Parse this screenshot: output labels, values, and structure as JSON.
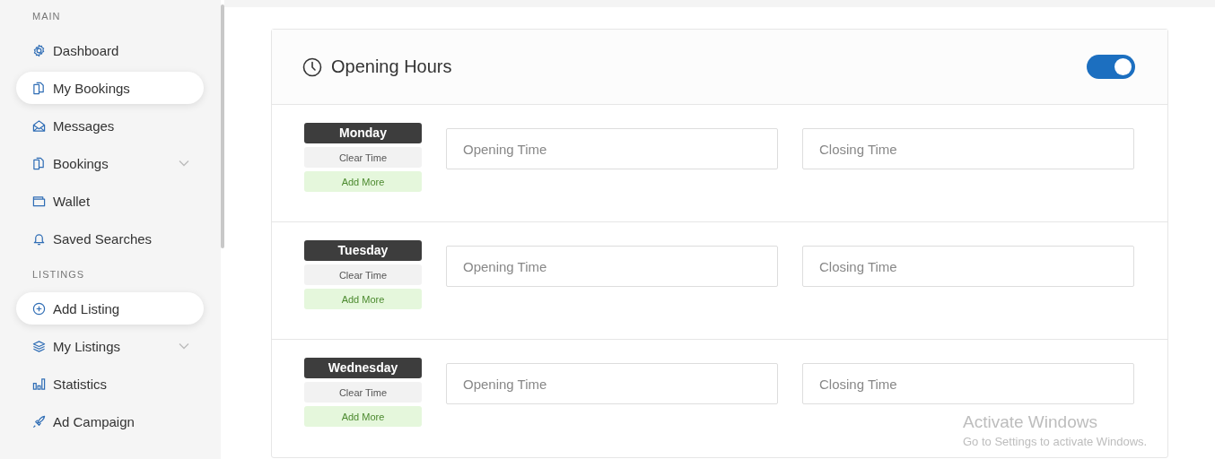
{
  "sidebar": {
    "sections": [
      {
        "heading": "MAIN",
        "items": [
          {
            "label": "Dashboard",
            "selected": false,
            "expandable": false
          },
          {
            "label": "My Bookings",
            "selected": true,
            "expandable": false
          },
          {
            "label": "Messages",
            "selected": false,
            "expandable": false
          },
          {
            "label": "Bookings",
            "selected": false,
            "expandable": true
          },
          {
            "label": "Wallet",
            "selected": false,
            "expandable": false
          },
          {
            "label": "Saved Searches",
            "selected": false,
            "expandable": false
          }
        ]
      },
      {
        "heading": "LISTINGS",
        "items": [
          {
            "label": "Add Listing",
            "selected": true,
            "expandable": false
          },
          {
            "label": "My Listings",
            "selected": false,
            "expandable": true
          },
          {
            "label": "Statistics",
            "selected": false,
            "expandable": false
          },
          {
            "label": "Ad Campaign",
            "selected": false,
            "expandable": false
          }
        ]
      }
    ]
  },
  "opening_hours": {
    "title": "Opening Hours",
    "on": true,
    "days": [
      {
        "day": "Monday",
        "clear_label": "Clear Time",
        "add_label": "Add More",
        "opening_placeholder": "Opening Time",
        "closing_placeholder": "Closing Time"
      },
      {
        "day": "Tuesday",
        "clear_label": "Clear Time",
        "add_label": "Add More",
        "opening_placeholder": "Opening Time",
        "closing_placeholder": "Closing Time"
      },
      {
        "day": "Wednesday",
        "clear_label": "Clear Time",
        "add_label": "Add More",
        "opening_placeholder": "Opening Time",
        "closing_placeholder": "Closing Time"
      }
    ]
  },
  "os_notice": {
    "title": "Activate Windows",
    "text": "Go to Settings to activate Windows."
  }
}
